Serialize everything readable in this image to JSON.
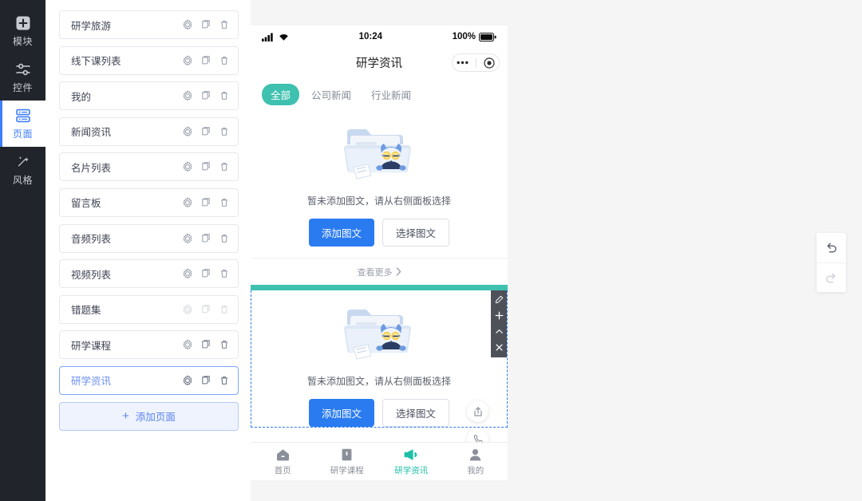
{
  "rail": {
    "items": [
      {
        "label": "模块",
        "icon": "plus-square-icon",
        "active": false
      },
      {
        "label": "控件",
        "icon": "widgets-icon",
        "active": false
      },
      {
        "label": "页面",
        "icon": "pages-icon",
        "active": true
      },
      {
        "label": "风格",
        "icon": "magic-wand-icon",
        "active": false
      }
    ]
  },
  "pagelist": {
    "add_label": "添加页面",
    "rows": [
      {
        "name": "研学旅游",
        "selected": false,
        "dimmed": false
      },
      {
        "name": "线下课列表",
        "selected": false,
        "dimmed": false
      },
      {
        "name": "我的",
        "selected": false,
        "dimmed": false
      },
      {
        "name": "新闻资讯",
        "selected": false,
        "dimmed": false
      },
      {
        "name": "名片列表",
        "selected": false,
        "dimmed": false
      },
      {
        "name": "留言板",
        "selected": false,
        "dimmed": false
      },
      {
        "name": "音频列表",
        "selected": false,
        "dimmed": false
      },
      {
        "name": "视频列表",
        "selected": false,
        "dimmed": false
      },
      {
        "name": "错题集",
        "selected": false,
        "dimmed": true
      },
      {
        "name": "研学课程",
        "selected": false,
        "dimmed": false
      },
      {
        "name": "研学资讯",
        "selected": true,
        "dimmed": false
      }
    ],
    "row_actions": [
      "gear-icon",
      "copy-icon",
      "trash-icon"
    ]
  },
  "phone": {
    "statusbar": {
      "time": "10:24",
      "battery": "100%",
      "signal_icon": "signal-bars-icon",
      "wifi_icon": "wifi-icon",
      "battery_icon": "battery-full-icon"
    },
    "navbar": {
      "title": "研学资讯",
      "capsule_more_icon": "more-dots-icon",
      "capsule_target_icon": "target-circle-icon"
    },
    "tabs": [
      {
        "label": "全部",
        "active": true
      },
      {
        "label": "公司新闻",
        "active": false
      },
      {
        "label": "行业新闻",
        "active": false
      }
    ],
    "empty_state": {
      "illustration": "owl-folder-illustration",
      "tip": "暂未添加图文，请从右侧面板选择",
      "primary_label": "添加图文",
      "ghost_label": "选择图文"
    },
    "see_more": {
      "label": "查看更多",
      "icon": "chevron-right-icon"
    },
    "selected_block": {
      "illustration": "owl-folder-illustration",
      "tip": "暂未添加图文，请从右侧面板选择",
      "primary_label": "添加图文",
      "ghost_label": "选择图文",
      "toolbar": [
        {
          "icon": "pencil-icon"
        },
        {
          "icon": "plus-icon"
        },
        {
          "icon": "chevron-up-icon"
        },
        {
          "icon": "close-icon"
        }
      ]
    },
    "fabs": [
      {
        "icon": "share-icon"
      },
      {
        "icon": "phone-icon"
      }
    ],
    "tabbar": [
      {
        "label": "首页",
        "icon": "home-icon",
        "active": false
      },
      {
        "label": "研学课程",
        "icon": "book-icon",
        "active": false
      },
      {
        "label": "研学资讯",
        "icon": "megaphone-icon",
        "active": true
      },
      {
        "label": "我的",
        "icon": "person-icon",
        "active": false
      }
    ]
  },
  "history": {
    "undo": {
      "icon": "undo-icon",
      "enabled": true
    },
    "redo": {
      "icon": "redo-icon",
      "enabled": false
    }
  },
  "colors": {
    "accent_blue": "#2a7bf0",
    "accent_teal": "#3fc1b0",
    "rail_bg": "#22242b",
    "selected_border": "#7aa6fb"
  }
}
